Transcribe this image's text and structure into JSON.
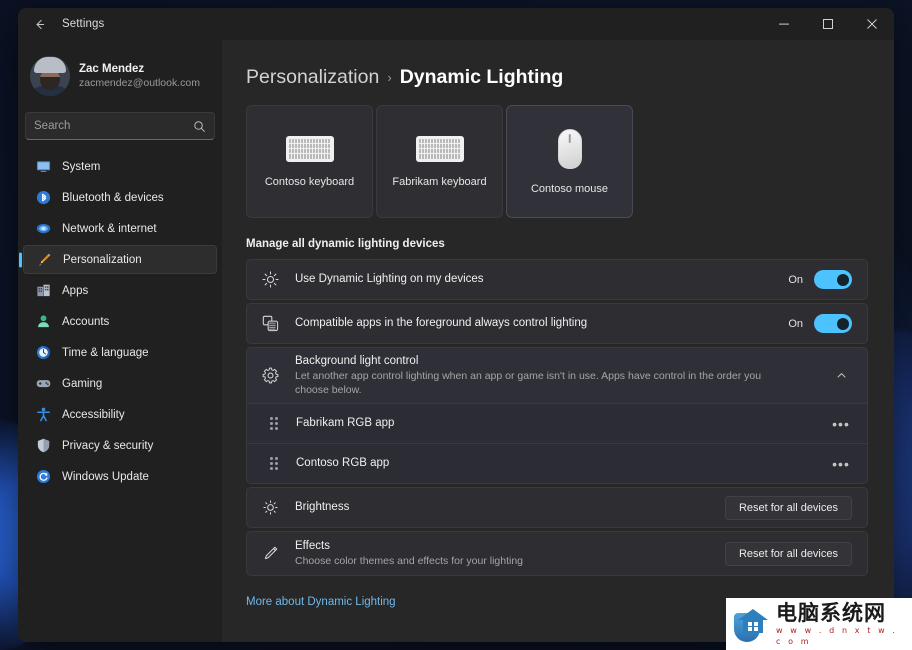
{
  "window": {
    "title": "Settings",
    "back_icon": "back-arrow-icon",
    "minimize_label": "─",
    "maximize_label": "□",
    "close_label": "✕"
  },
  "sidebar": {
    "profile": {
      "name": "Zac Mendez",
      "email": "zacmendez@outlook.com"
    },
    "search": {
      "placeholder": "Search",
      "value": "",
      "icon": "search-icon"
    },
    "items": [
      {
        "label": "System",
        "icon": "system-icon",
        "active": false
      },
      {
        "label": "Bluetooth & devices",
        "icon": "bluetooth-icon",
        "active": false
      },
      {
        "label": "Network & internet",
        "icon": "network-icon",
        "active": false
      },
      {
        "label": "Personalization",
        "icon": "personalization-brush-icon",
        "active": true
      },
      {
        "label": "Apps",
        "icon": "apps-icon",
        "active": false
      },
      {
        "label": "Accounts",
        "icon": "accounts-icon",
        "active": false
      },
      {
        "label": "Time & language",
        "icon": "clock-icon",
        "active": false
      },
      {
        "label": "Gaming",
        "icon": "gamepad-icon",
        "active": false
      },
      {
        "label": "Accessibility",
        "icon": "accessibility-icon",
        "active": false
      },
      {
        "label": "Privacy & security",
        "icon": "shield-icon",
        "active": false
      },
      {
        "label": "Windows Update",
        "icon": "update-icon",
        "active": false
      }
    ]
  },
  "content": {
    "breadcrumb": {
      "parent": "Personalization",
      "separator": "›",
      "current": "Dynamic Lighting"
    },
    "devices": [
      {
        "name": "Contoso keyboard",
        "art": "keyboard",
        "selected": false
      },
      {
        "name": "Fabrikam keyboard",
        "art": "keyboard",
        "selected": false
      },
      {
        "name": "Contoso mouse",
        "art": "mouse",
        "selected": true
      }
    ],
    "section_title": "Manage all dynamic lighting devices",
    "rows": {
      "use_dynamic_lighting": {
        "title": "Use Dynamic Lighting on my devices",
        "icon": "brightness-sun-icon",
        "toggle_state": "On"
      },
      "compatible_apps": {
        "title": "Compatible apps in the foreground always control lighting",
        "icon": "overlapping-windows-icon",
        "toggle_state": "On"
      },
      "background_light_control": {
        "title": "Background light control",
        "subtitle": "Let another app control lighting when an app or game isn't in use. Apps have control in the order you choose below.",
        "icon": "gear-icon",
        "expand_icon": "chevron-up-icon"
      },
      "apps": [
        {
          "name": "Fabrikam RGB app",
          "handle_icon": "drag-handle-icon",
          "menu_icon": "more-options-icon",
          "menu_label": "•••"
        },
        {
          "name": "Contoso RGB app",
          "handle_icon": "drag-handle-icon",
          "menu_icon": "more-options-icon",
          "menu_label": "•••"
        }
      ],
      "brightness": {
        "title": "Brightness",
        "icon": "brightness-icon",
        "button_label": "Reset for all devices"
      },
      "effects": {
        "title": "Effects",
        "subtitle": "Choose color themes and effects for your lighting",
        "icon": "effects-brush-icon",
        "button_label": "Reset for all devices"
      }
    },
    "more_link": "More about Dynamic Lighting"
  },
  "watermark": {
    "title_cn": "电脑系统网",
    "url": "w w w . d n x t w . c o m",
    "logo_icon": "house-shield-logo-icon"
  },
  "colors": {
    "accent": "#4cc2ff",
    "link": "#6fb8e8",
    "window_bg": "#202020",
    "content_bg": "#272727",
    "card_bg": "#2e2e32"
  }
}
